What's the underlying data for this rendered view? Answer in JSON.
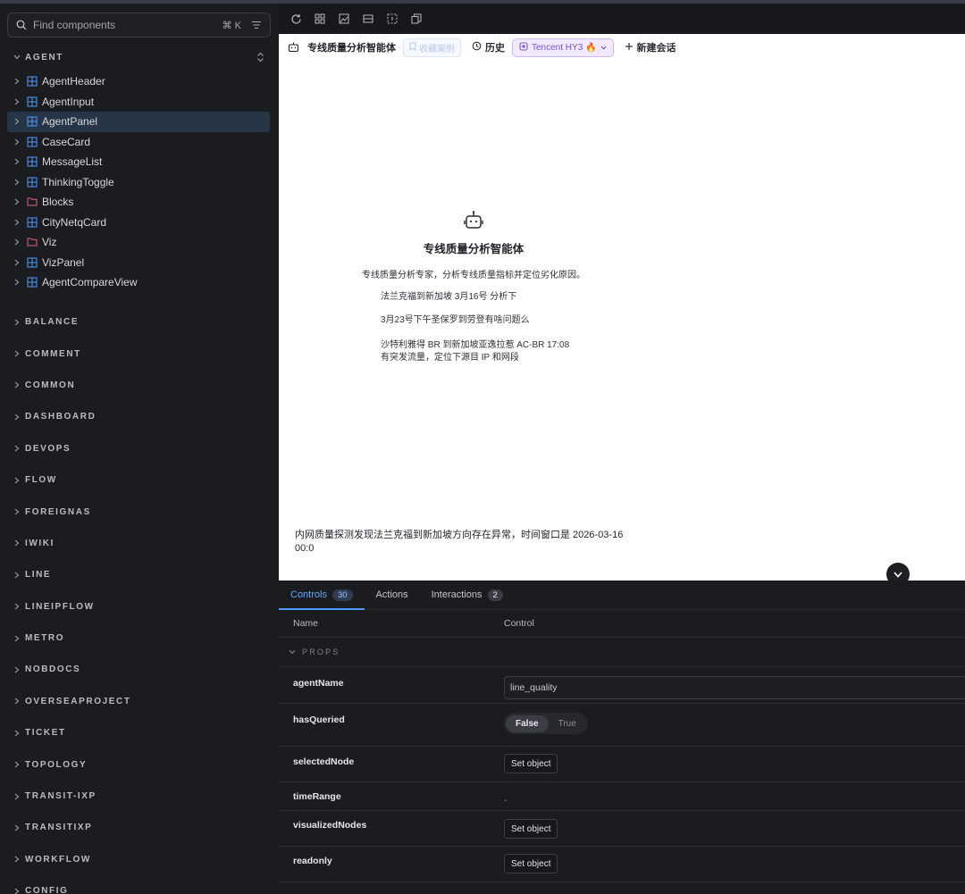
{
  "sidebar": {
    "search_placeholder": "Find components",
    "search_shortcut": "⌘ K",
    "section_agent": "AGENT",
    "items": [
      {
        "label": "AgentHeader",
        "type": "component"
      },
      {
        "label": "AgentInput",
        "type": "component"
      },
      {
        "label": "AgentPanel",
        "type": "component",
        "selected": true
      },
      {
        "label": "CaseCard",
        "type": "component"
      },
      {
        "label": "MessageList",
        "type": "component"
      },
      {
        "label": "ThinkingToggle",
        "type": "component"
      },
      {
        "label": "Blocks",
        "type": "folder"
      },
      {
        "label": "CityNetqCard",
        "type": "component"
      },
      {
        "label": "Viz",
        "type": "folder"
      },
      {
        "label": "VizPanel",
        "type": "component"
      },
      {
        "label": "AgentCompareView",
        "type": "component"
      }
    ],
    "groups": [
      "BALANCE",
      "COMMENT",
      "COMMON",
      "DASHBOARD",
      "DEVOPS",
      "FLOW",
      "FOREIGNAS",
      "IWIKI",
      "LINE",
      "LINEIPFLOW",
      "METRO",
      "NOBDOCS",
      "OVERSEAPROJECT",
      "TICKET",
      "TOPOLOGY",
      "TRANSIT-IXP",
      "TRANSITIXP",
      "WORKFLOW",
      "CONFIG"
    ]
  },
  "toolbar": {
    "icons": [
      "refresh-icon",
      "grid-icon",
      "image-icon",
      "layout-icon",
      "outline-icon",
      "copy-icon"
    ]
  },
  "preview": {
    "header": {
      "agent_name": "专线质量分析智能体",
      "favorite_label": "收藏案例",
      "history_label": "历史",
      "model_label": "Tencent HY3 🔥",
      "new_chat_label": "新建会话"
    },
    "welcome": {
      "title": "专线质量分析智能体",
      "description": "专线质量分析专家，分析专线质量指标并定位劣化原因。",
      "suggestions": [
        "法兰克福到新加坡 3月16号 分析下",
        "3月23号下午圣保罗到劳登有啥问题么",
        "沙特利雅得 BR 到新加坡亚逸拉惹 AC-BR 17:08",
        "有突发流量，定位下源目 IP 和网段"
      ]
    },
    "input_text_line1": "内网质量探测发现法兰克福到新加坡方向存在异常，时间窗口是 2026-03-16",
    "input_text_line2": "00:0"
  },
  "addon": {
    "tabs": [
      {
        "label": "Controls",
        "badge": "30",
        "active": true
      },
      {
        "label": "Actions",
        "badge": null,
        "active": false
      },
      {
        "label": "Interactions",
        "badge": "2",
        "active": false
      }
    ],
    "col_name": "Name",
    "col_control": "Control",
    "props_label": "PROPS",
    "rows": {
      "agentName": {
        "name": "agentName",
        "value": "line_quality"
      },
      "hasQueried": {
        "name": "hasQueried",
        "opt_false": "False",
        "opt_true": "True"
      },
      "selectedNode": {
        "name": "selectedNode",
        "button": "Set object"
      },
      "timeRange": {
        "name": "timeRange",
        "value": "-"
      },
      "visualizedNodes": {
        "name": "visualizedNodes",
        "button": "Set object"
      },
      "readonly": {
        "name": "readonly",
        "button": "Set object"
      }
    }
  }
}
